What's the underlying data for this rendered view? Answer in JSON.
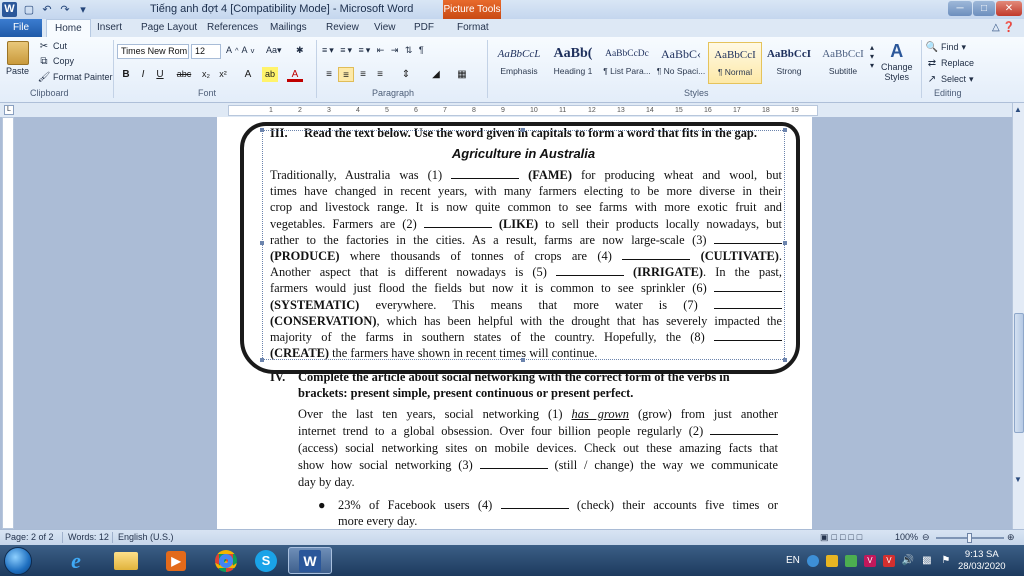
{
  "window": {
    "title": "Tiếng anh đợt 4 [Compatibility Mode] - Microsoft Word",
    "contextual_tab": "Picture Tools"
  },
  "tabs": {
    "file": "File",
    "items": [
      "Home",
      "Insert",
      "Page Layout",
      "References",
      "Mailings",
      "Review",
      "View",
      "PDF",
      "Format"
    ],
    "active": "Home"
  },
  "ribbon": {
    "clipboard": {
      "paste": "Paste",
      "cut": "Cut",
      "copy": "Copy",
      "format_painter": "Format Painter",
      "label": "Clipboard"
    },
    "font": {
      "name": "Times New Rom",
      "size": "12",
      "label": "Font"
    },
    "paragraph": {
      "label": "Paragraph"
    },
    "styles": {
      "items": [
        {
          "sample": "AaBbCcL",
          "name": "Emphasis"
        },
        {
          "sample": "AaBb(",
          "name": "Heading 1"
        },
        {
          "sample": "AaBbCcDc",
          "name": "¶ List Para..."
        },
        {
          "sample": "AaBbC‹",
          "name": "¶ No Spaci..."
        },
        {
          "sample": "AaBbCcI",
          "name": "¶ Normal"
        },
        {
          "sample": "AaBbCcI",
          "name": "Strong"
        },
        {
          "sample": "AaBbCcI",
          "name": "Subtitle"
        }
      ],
      "selected_index": 4,
      "change_styles_line1": "Change",
      "change_styles_line2": "Styles",
      "label": "Styles"
    },
    "editing": {
      "find": "Find",
      "replace": "Replace",
      "select": "Select",
      "label": "Editing"
    }
  },
  "ruler": {
    "numbers": [
      "1",
      "2",
      "3",
      "4",
      "5",
      "6",
      "7",
      "8",
      "9",
      "10",
      "11",
      "12",
      "13",
      "14",
      "15",
      "16",
      "17",
      "18",
      "19"
    ]
  },
  "document": {
    "section3": {
      "number": "III.",
      "instruction": "Read the text below. Use the word given in capitals to form a word that fits in the gap.",
      "title": "Agriculture in Australia",
      "lines": [
        [
          "  Traditionally, Australia was (1) ",
          "_",
          " ",
          "(FAME)",
          " for producing wheat and wool, but"
        ],
        [
          "times have changed in recent years, with many farmers electing to be more diverse in their"
        ],
        [
          "crop and livestock range. It is now quite common to see farms with more exotic fruit and"
        ],
        [
          "vegetables. Farmers are (2) ",
          "_",
          " ",
          "(LIKE)",
          " to sell their products locally nowadays, but"
        ],
        [
          "rather to the factories in the cities. As a result, farms are now large-scale (3) ",
          "_"
        ],
        [
          "(PRODUCE)",
          " where thousands of tonnes of crops are (4) ",
          "_",
          " ",
          "(CULTIVATE)",
          "."
        ],
        [
          "Another aspect that is different nowadays is (5) ",
          "_",
          " ",
          "(IRRIGATE)",
          ". In the past,"
        ],
        [
          "farmers would just flood the fields but now it is common to see sprinkler (6) ",
          "_"
        ],
        [
          "(SYSTEMATIC)",
          " everywhere. This means that more water is (7) ",
          "_"
        ],
        [
          "(CONSERVATION)",
          ", which has been helpful with the drought that has severely impacted the"
        ],
        [
          "majority of the farms in southern states of the country. Hopefully, the (8) ",
          "_"
        ],
        [
          "(CREATE)",
          " the farmers have shown in recent times will continue."
        ]
      ]
    },
    "section4": {
      "number": "IV.",
      "instruction_line1": "Complete the article about social networking with the correct form of the verbs in",
      "instruction_line2": "brackets: present simple, present continuous or present perfect.",
      "lines": [
        [
          "Over the last ten years, social networking (1) ",
          "has grown",
          " (grow) from just another"
        ],
        [
          "internet trend to a global obsession. Over four billion people regularly (2) ",
          "_"
        ],
        [
          "(access) social networking sites on mobile devices. Check out these amazing facts that"
        ],
        [
          "show how social networking (3) ",
          "_",
          " (still / change) the way we communicate"
        ],
        [
          "day by day."
        ]
      ],
      "bullet_line1": [
        "23% of Facebook users (4) ",
        "_",
        " (check) their accounts five times or"
      ],
      "bullet_line2": "more every day."
    }
  },
  "status": {
    "page": "Page: 2 of 2",
    "words": "Words: 12",
    "language": "English (U.S.)",
    "zoom": "100%"
  },
  "taskbar": {
    "language": "EN",
    "time": "9:13 SA",
    "date": "28/03/2020"
  },
  "colors": {
    "accent": "#2b579a",
    "file_tab": "#2a66b8",
    "picture_tools": "#d8581d",
    "document_background": "#abbcd6"
  },
  "icons": [
    "word-icon",
    "save-icon",
    "undo-icon",
    "redo-icon",
    "cut-icon",
    "copy-icon",
    "format-painter-icon",
    "find-icon",
    "replace-icon",
    "select-icon",
    "minimize-icon",
    "maximize-icon",
    "close-icon",
    "help-icon",
    "start-icon",
    "ie-icon",
    "folder-icon",
    "media-icon",
    "chrome-icon",
    "skype-icon",
    "word-taskbar-icon"
  ]
}
